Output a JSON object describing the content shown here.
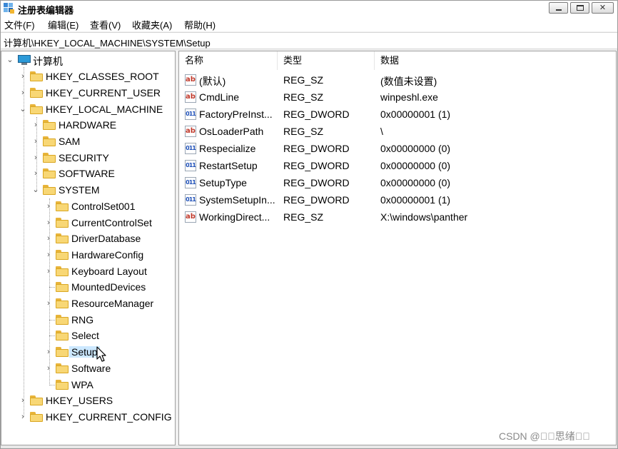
{
  "window": {
    "title": "注册表编辑器"
  },
  "menu": [
    "文件(F)",
    "编辑(E)",
    "查看(V)",
    "收藏夹(A)",
    "帮助(H)"
  ],
  "address": "计算机\\HKEY_LOCAL_MACHINE\\SYSTEM\\Setup",
  "tree": {
    "root": "计算机",
    "hives": {
      "classes_root": "HKEY_CLASSES_ROOT",
      "current_user": "HKEY_CURRENT_USER",
      "local_machine": "HKEY_LOCAL_MACHINE",
      "users": "HKEY_USERS",
      "current_config": "HKEY_CURRENT_CONFIG"
    },
    "hklm": [
      "HARDWARE",
      "SAM",
      "SECURITY",
      "SOFTWARE",
      "SYSTEM"
    ],
    "system": [
      "ControlSet001",
      "CurrentControlSet",
      "DriverDatabase",
      "HardwareConfig",
      "Keyboard Layout",
      "MountedDevices",
      "ResourceManager",
      "RNG",
      "Select",
      "Setup",
      "Software",
      "WPA"
    ],
    "selected": "Setup"
  },
  "list": {
    "columns": [
      "名称",
      "类型",
      "数据"
    ],
    "rows": [
      {
        "name": "(默认)",
        "type": "REG_SZ",
        "data": "(数值未设置)",
        "icon": "string-value-icon"
      },
      {
        "name": "CmdLine",
        "type": "REG_SZ",
        "data": "winpeshl.exe",
        "icon": "string-value-icon"
      },
      {
        "name": "FactoryPreInst...",
        "type": "REG_DWORD",
        "data": "0x00000001 (1)",
        "icon": "binary-value-icon"
      },
      {
        "name": "OsLoaderPath",
        "type": "REG_SZ",
        "data": "\\",
        "icon": "string-value-icon"
      },
      {
        "name": "Respecialize",
        "type": "REG_DWORD",
        "data": "0x00000000 (0)",
        "icon": "binary-value-icon"
      },
      {
        "name": "RestartSetup",
        "type": "REG_DWORD",
        "data": "0x00000000 (0)",
        "icon": "binary-value-icon"
      },
      {
        "name": "SetupType",
        "type": "REG_DWORD",
        "data": "0x00000000 (0)",
        "icon": "binary-value-icon"
      },
      {
        "name": "SystemSetupIn...",
        "type": "REG_DWORD",
        "data": "0x00000001 (1)",
        "icon": "binary-value-icon"
      },
      {
        "name": "WorkingDirect...",
        "type": "REG_SZ",
        "data": "X:\\windows\\panther",
        "icon": "string-value-icon"
      }
    ]
  },
  "watermark": "CSDN @\u0000\u0000思绪\u0000\u0000"
}
